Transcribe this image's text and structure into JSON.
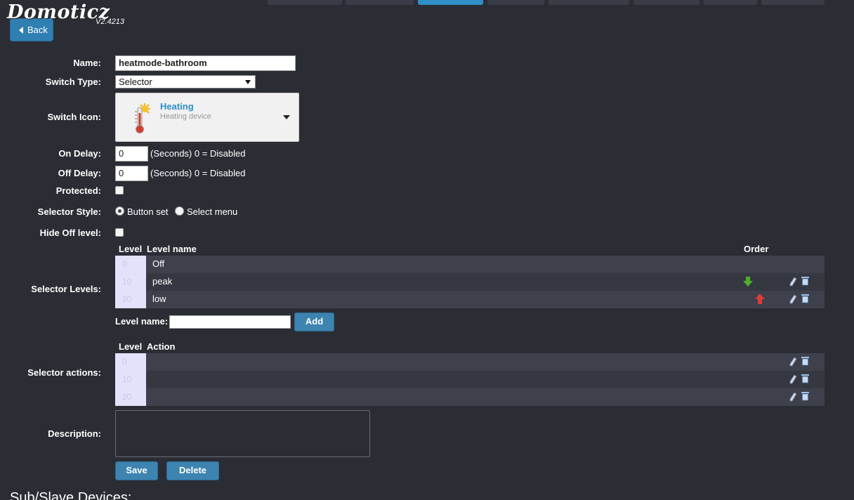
{
  "app": {
    "logo": "Domoticz",
    "version": "V2.4213"
  },
  "back_label": "Back",
  "labels": {
    "name": "Name:",
    "switch_type": "Switch Type:",
    "switch_icon": "Switch Icon:",
    "on_delay": "On Delay:",
    "off_delay": "Off Delay:",
    "protected": "Protected:",
    "selector_style": "Selector Style:",
    "hide_off_level": "Hide Off level:",
    "selector_levels": "Selector Levels:",
    "selector_actions": "Selector actions:",
    "description": "Description:",
    "level_name": "Level name:"
  },
  "name_value": "heatmode-bathroom",
  "switch_type_selected": "Selector",
  "switch_icon": {
    "title": "Heating",
    "subtitle": "Heating device",
    "icon": "thermometer-sun-icon"
  },
  "on_delay": {
    "value": "0",
    "suffix": "(Seconds) 0 = Disabled"
  },
  "off_delay": {
    "value": "0",
    "suffix": "(Seconds) 0 = Disabled"
  },
  "protected_checked": false,
  "hide_off_checked": false,
  "selector_style": {
    "options": [
      "Button set",
      "Select menu"
    ],
    "selected": "Button set"
  },
  "levels_table": {
    "headers": {
      "level": "Level",
      "name": "Level name",
      "order": "Order"
    },
    "rows": [
      {
        "level": "0",
        "name": "Off"
      },
      {
        "level": "10",
        "name": "peak"
      },
      {
        "level": "20",
        "name": "low"
      }
    ]
  },
  "add_button": "Add",
  "actions_table": {
    "headers": {
      "level": "Level",
      "action": "Action"
    },
    "rows": [
      {
        "level": "0",
        "action": ""
      },
      {
        "level": "10",
        "action": ""
      },
      {
        "level": "20",
        "action": ""
      }
    ]
  },
  "save_button": "Save",
  "delete_button": "Delete",
  "subslave_title": "Sub/Slave Devices:",
  "colors": {
    "accent": "#2f8fc6",
    "background": "#2b2d35",
    "button": "#3d84b0",
    "arrow_down": "#4caf2a",
    "arrow_up": "#e03a3a"
  }
}
